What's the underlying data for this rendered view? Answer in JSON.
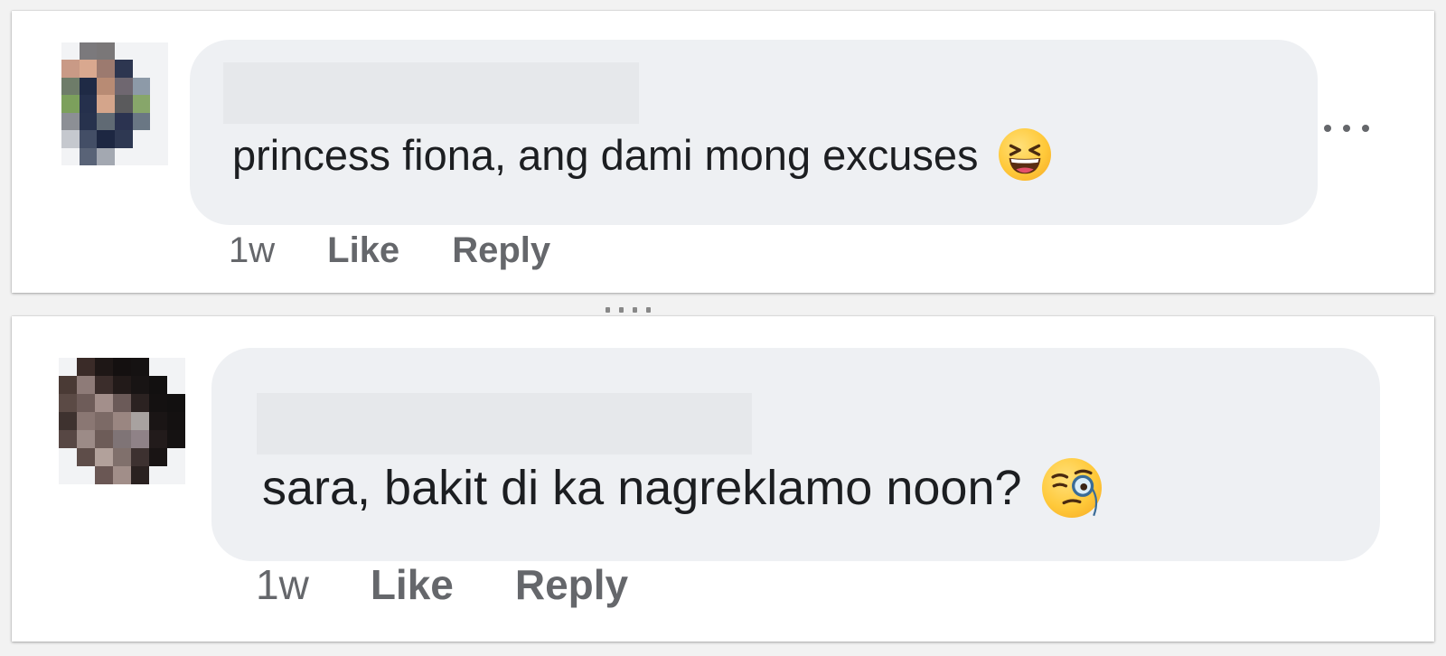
{
  "comments": [
    {
      "text": "princess fiona, ang dami mong excuses",
      "emoji_icon": "grinning-squinting-face-icon",
      "time": "1w",
      "like_label": "Like",
      "reply_label": "Reply"
    },
    {
      "text": "sara, bakit di ka nagreklamo noon?",
      "emoji_icon": "face-with-monocle-icon",
      "time": "1w",
      "like_label": "Like",
      "reply_label": "Reply"
    }
  ],
  "more_icon": "more-horizontal-icon",
  "colors": {
    "bubble": "#eef0f3",
    "comment_text": "#1c1e21",
    "meta_text": "#65676b"
  }
}
